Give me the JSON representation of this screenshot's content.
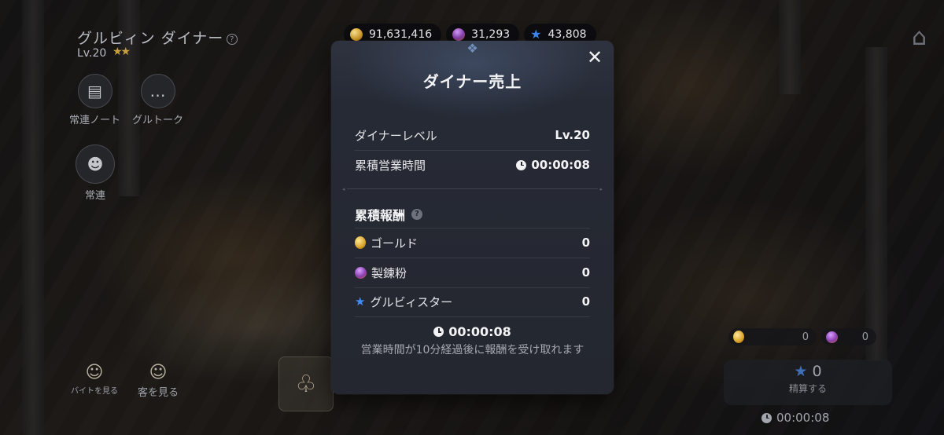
{
  "currency": {
    "gold": "91,631,416",
    "powder": "31,293",
    "gems": "43,808"
  },
  "diner": {
    "name": "グルビィン ダイナー",
    "level": "Lv.20",
    "buttons": {
      "regular_note": "常連ノート",
      "guru_talk": "グルトーク",
      "regulars": "常連",
      "part_time": "バイトを見る",
      "view_guests": "客を見る"
    }
  },
  "modal": {
    "title": "ダイナー売上",
    "close": "✕",
    "diner_level_label": "ダイナーレベル",
    "diner_level_value": "Lv.20",
    "total_time_label": "累積営業時間",
    "total_time_value": "00:00:08",
    "rewards_title": "累積報酬",
    "rewards": [
      {
        "label": "ゴールド",
        "value": "0",
        "icon": "gold-coin-icon"
      },
      {
        "label": "製錬粉",
        "value": "0",
        "icon": "refining-powder-icon"
      },
      {
        "label": "グルビィスター",
        "value": "0",
        "icon": "gourbi-star-icon"
      }
    ],
    "timer": "00:00:08",
    "notice": "営業時間が10分経過後に報酬を受け取れます"
  },
  "right_panel": {
    "gold_count": "0",
    "powder_count": "0",
    "star_count": "0",
    "settle_label": "精算する",
    "timer": "00:00:08"
  },
  "colors": {
    "modal_bg": "#24272f",
    "accent_blue": "#3f8cff",
    "gold": "#d9a226"
  }
}
